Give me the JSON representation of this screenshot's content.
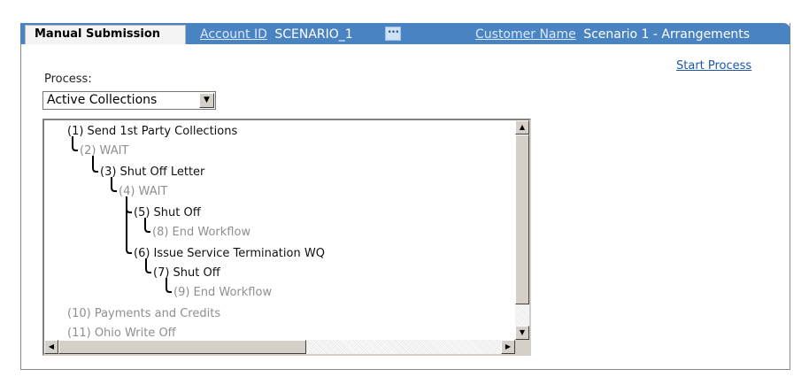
{
  "header": {
    "tab_label": "Manual Submission",
    "account_id_label": "Account ID",
    "account_id_value": "SCENARIO_1",
    "search_icon": "ellipsis-search-icon",
    "customer_name_label": "Customer Name",
    "customer_name_value": "Scenario 1 - Arrangements"
  },
  "start_process_label": "Start Process",
  "process": {
    "label": "Process:",
    "selected": "Active Collections"
  },
  "tree": {
    "nodes": [
      {
        "label": "(1) Send 1st Party Collections",
        "state": "active"
      },
      {
        "label": "(2) WAIT",
        "state": "inactive"
      },
      {
        "label": "(3) Shut Off Letter",
        "state": "active"
      },
      {
        "label": "(4) WAIT",
        "state": "inactive"
      },
      {
        "label": "(5) Shut Off",
        "state": "active"
      },
      {
        "label": "(8) End Workflow",
        "state": "inactive"
      },
      {
        "label": "(6) Issue Service Termination WQ",
        "state": "active"
      },
      {
        "label": "(7) Shut Off",
        "state": "active"
      },
      {
        "label": "(9) End Workflow",
        "state": "inactive"
      },
      {
        "label": "(10) Payments and Credits",
        "state": "inactive"
      },
      {
        "label": "(11) Ohio Write Off",
        "state": "inactive"
      }
    ]
  },
  "colors": {
    "header_blue": "#4a83c2",
    "link_blue": "#1d57a5",
    "inactive_text": "#8f8f8f"
  }
}
